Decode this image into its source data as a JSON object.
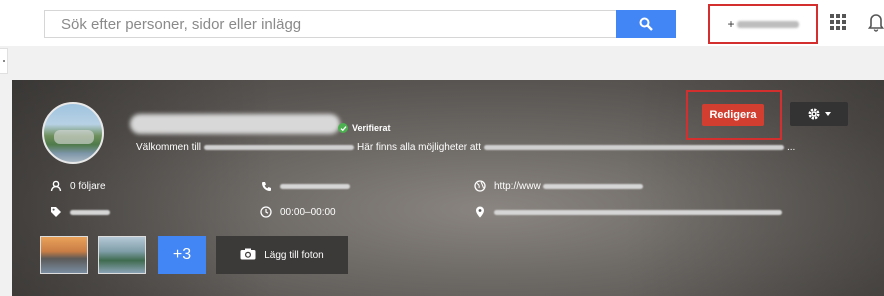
{
  "search": {
    "placeholder": "Sök efter personer, sidor eller inlägg",
    "button_icon": "search-icon"
  },
  "header": {
    "user_prefix": "+",
    "apps_icon": "apps-grid-icon",
    "notifications_icon": "bell-icon"
  },
  "profile": {
    "verified_label": "Verifierat",
    "about_prefix": "Välkommen till",
    "about_middle": "Här finns alla möjligheter att",
    "about_suffix": "...",
    "followers": "0 följare",
    "website": "http://www",
    "hours": "00:00–00:00",
    "edit_label": "Redigera",
    "more_photos": "+3",
    "add_photos_label": "Lägg till foton"
  },
  "colors": {
    "search_button": "#4285f4",
    "edit_button": "#d23f31",
    "highlight_frame": "#d32f2f",
    "verified": "#4caf50"
  }
}
